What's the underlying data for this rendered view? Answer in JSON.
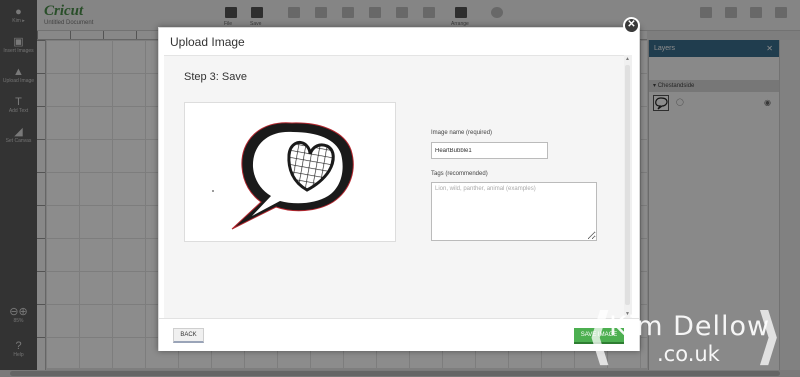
{
  "app": {
    "brand": "Cricut",
    "document_name": "Untitled Document",
    "toolbar": {
      "open_label": "File",
      "save_label": "Save",
      "arrange_label": "Arrange"
    },
    "sidebar": {
      "items": [
        {
          "icon": "person-icon",
          "label": "Kim ▸"
        },
        {
          "icon": "image-icon",
          "label": "Insert Images"
        },
        {
          "icon": "upload-icon",
          "label": "Upload Image"
        },
        {
          "icon": "text-icon",
          "label": "Add Text"
        },
        {
          "icon": "shirt-icon",
          "label": "Set Canvas"
        }
      ],
      "zoom_label": "85%",
      "help_label": "Help"
    },
    "layers": {
      "title": "Layers",
      "group_name": "Chestandside"
    }
  },
  "modal": {
    "title": "Upload Image",
    "step_title": "Step 3: Save",
    "image_name_label": "Image name (required)",
    "image_name_value": "HeartBubble1",
    "tags_label": "Tags (recommended)",
    "tags_placeholder": "Lion, wild, panther, animal (examples)",
    "back_label": "BACK",
    "save_label": "SAVE IMAGE",
    "preview_icon": "heart-speech-bubble-image"
  },
  "watermark": {
    "line1": "Kim Dellow",
    "line2": ".co.uk"
  },
  "colors": {
    "accent_green": "#4caf50",
    "layers_header": "#3b6f8e",
    "brand_green": "#4c8e4c"
  }
}
